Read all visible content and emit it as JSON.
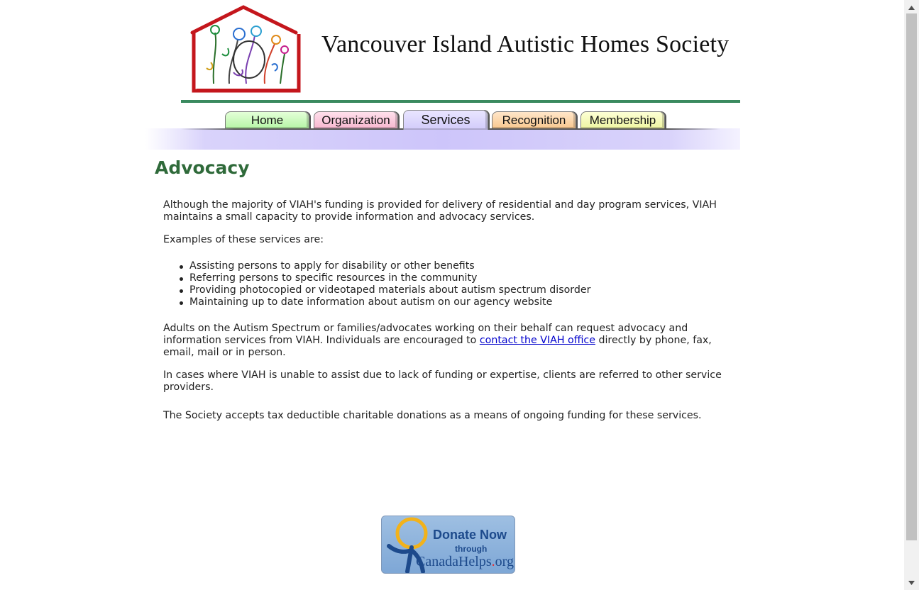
{
  "site": {
    "title": "Vancouver Island Autistic Homes Society"
  },
  "nav": {
    "tabs": [
      {
        "label": "Home"
      },
      {
        "label": "Organization"
      },
      {
        "label": "Services",
        "active": true
      },
      {
        "label": "Recognition"
      },
      {
        "label": "Membership"
      }
    ]
  },
  "main": {
    "title": "Advocacy",
    "p1": "Although the majority of VIAH's funding is provided for delivery of residential and day program services, VIAH maintains a small capacity to provide information and advocacy services.",
    "p2": "Examples of these services are:",
    "list": [
      "Assisting persons to apply for disability or other benefits",
      "Referring persons to specific resources in the community",
      "Providing photocopied or videotaped materials about autism spectrum disorder",
      "Maintaining up to date information about autism on our agency website"
    ],
    "p3_before": "Adults on the Autism Spectrum or families/advocates working on their behalf can request advocacy and information services from VIAH. Individuals are encouraged to ",
    "p3_link": "contact the VIAH office",
    "p3_after": " directly by phone, fax, email, mail or in person.",
    "p4": "In cases where VIAH is unable to assist due to lack of funding or expertise, clients are referred to other service providers.",
    "p5": "The Society accepts tax deductible charitable donations as a means of ongoing funding for these services."
  },
  "donate": {
    "line1": "Donate Now",
    "line2": "through",
    "line3a": "CanadaHelps",
    "line3b": ".",
    "line3c": "org"
  },
  "colors": {
    "title_green": "#2f6a3a",
    "rule_green": "#3a8a5f",
    "link_blue": "#0000cc",
    "nav_band": "#cdc5fa"
  },
  "icons": [
    "house-logo-icon",
    "scroll-up-arrow-icon",
    "scroll-down-arrow-icon",
    "donate-figure-icon"
  ]
}
